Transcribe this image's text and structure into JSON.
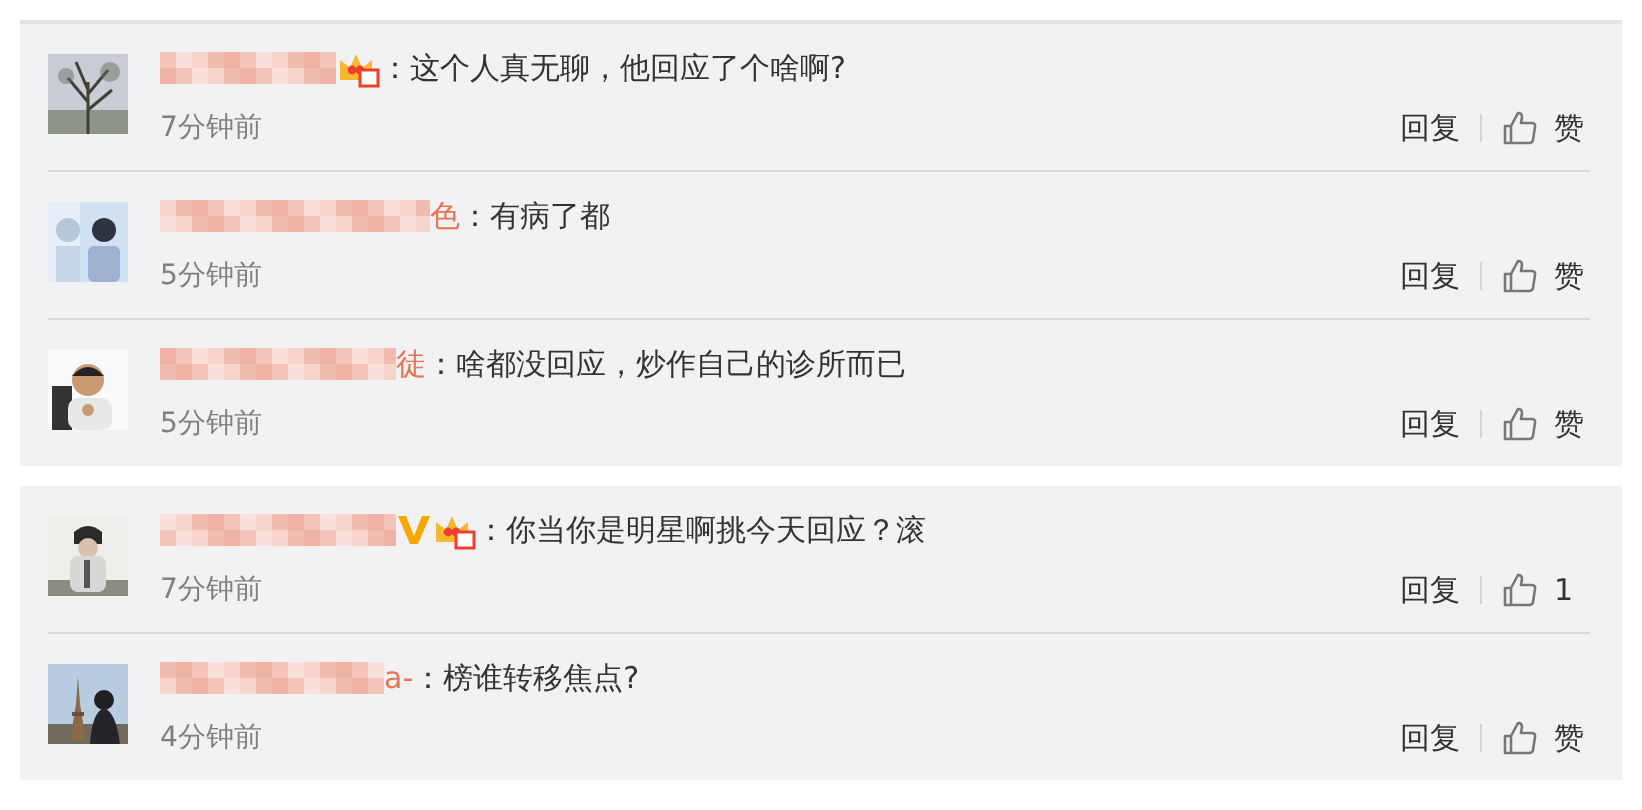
{
  "cards": [
    {
      "comments": [
        {
          "verified": false,
          "vip": true,
          "text": "：这个人真无聊，他回应了个啥啊?",
          "time": "7分钟前",
          "reply": "回复",
          "like": "赞"
        },
        {
          "name_tail": "色",
          "verified": false,
          "vip": false,
          "text": "：有病了都",
          "time": "5分钟前",
          "reply": "回复",
          "like": "赞"
        },
        {
          "name_tail": "徒",
          "verified": false,
          "vip": false,
          "text": "：啥都没回应，炒作自己的诊所而已",
          "time": "5分钟前",
          "reply": "回复",
          "like": "赞"
        }
      ]
    },
    {
      "comments": [
        {
          "verified": true,
          "vip": true,
          "text": "：你当你是明星啊挑今天回应？滚",
          "time": "7分钟前",
          "reply": "回复",
          "like": "1"
        },
        {
          "name_tail": "a-",
          "verified": false,
          "vip": false,
          "text": "：榜谁转移焦点?",
          "time": "4分钟前",
          "reply": "回复",
          "like": "赞"
        }
      ]
    }
  ]
}
